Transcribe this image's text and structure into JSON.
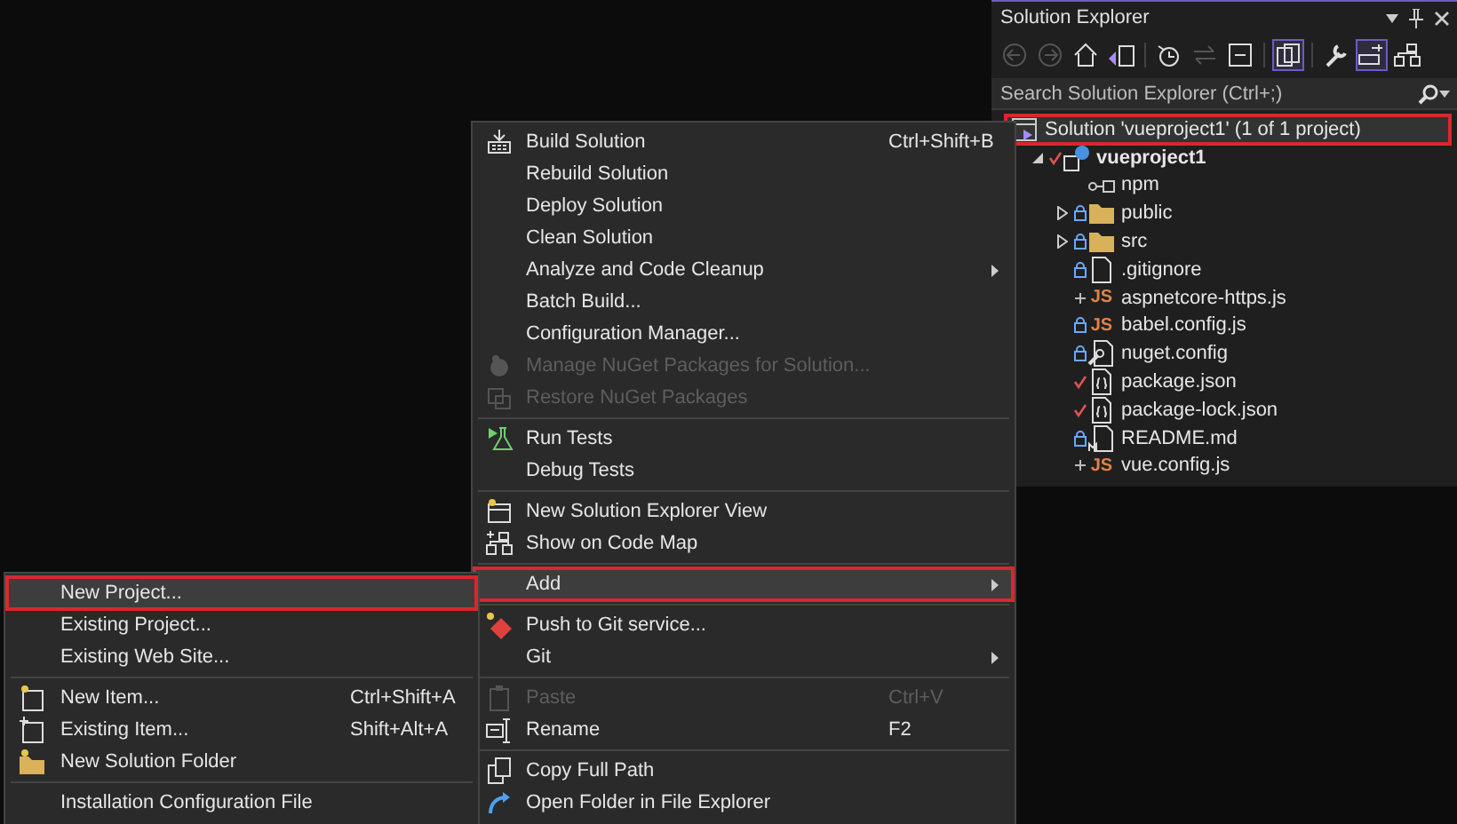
{
  "explorer": {
    "title": "Solution Explorer",
    "toolbar": [
      {
        "kind": "back",
        "on": false,
        "disabled": true
      },
      {
        "kind": "forward",
        "on": false,
        "disabled": true
      },
      {
        "kind": "home",
        "on": false,
        "disabled": false
      },
      {
        "kind": "switch-views",
        "on": false,
        "disabled": false
      },
      {
        "kind": "history",
        "on": false,
        "disabled": false
      },
      {
        "kind": "sync",
        "on": false,
        "disabled": true
      },
      {
        "kind": "collapse",
        "on": false,
        "disabled": false
      },
      {
        "kind": "show-all",
        "on": true,
        "disabled": false
      },
      {
        "kind": "properties",
        "on": false,
        "disabled": false
      },
      {
        "kind": "preview",
        "on": true,
        "disabled": false
      },
      {
        "kind": "code-map",
        "on": false,
        "disabled": false
      }
    ],
    "search": {
      "placeholder": "Search Solution Explorer (Ctrl+;)"
    },
    "tree": {
      "label": "Solution 'vueproject1' (1 of 1 project)",
      "kind": "solution",
      "highlighted": true,
      "children": [
        {
          "label": "vueproject1",
          "kind": "web-project",
          "checked_in": false,
          "pending_add": false,
          "pending_edit": true,
          "expanded": true,
          "children": [
            {
              "label": "npm",
              "kind": "dependency",
              "checked_in": false,
              "pending_add": false,
              "pending_edit": false
            },
            {
              "label": "public",
              "kind": "folder",
              "checked_in": true,
              "pending_add": false,
              "pending_edit": false,
              "expanded": false
            },
            {
              "label": "src",
              "kind": "folder",
              "checked_in": true,
              "pending_add": false,
              "pending_edit": false,
              "expanded": false
            },
            {
              "label": ".gitignore",
              "kind": "file",
              "checked_in": true,
              "pending_add": false,
              "pending_edit": false
            },
            {
              "label": "aspnetcore-https.js",
              "kind": "js",
              "badge": "JS",
              "checked_in": false,
              "pending_add": true,
              "pending_edit": false
            },
            {
              "label": "babel.config.js",
              "kind": "js",
              "badge": "JS",
              "checked_in": true,
              "pending_add": false,
              "pending_edit": false
            },
            {
              "label": "nuget.config",
              "kind": "config",
              "checked_in": true,
              "pending_add": false,
              "pending_edit": false
            },
            {
              "label": "package.json",
              "kind": "json",
              "checked_in": false,
              "pending_add": false,
              "pending_edit": true
            },
            {
              "label": "package-lock.json",
              "kind": "json",
              "checked_in": false,
              "pending_add": false,
              "pending_edit": true
            },
            {
              "label": "README.md",
              "kind": "markdown",
              "checked_in": true,
              "pending_add": false,
              "pending_edit": false
            },
            {
              "label": "vue.config.js",
              "kind": "js",
              "badge": "JS",
              "checked_in": false,
              "pending_add": true,
              "pending_edit": false
            }
          ]
        }
      ]
    }
  },
  "main_menu": {
    "items": [
      {
        "kind": "build",
        "label": "Build Solution",
        "shortcut": "Ctrl+Shift+B",
        "disabled": false,
        "selected": false,
        "highlighted": false,
        "submenu": false
      },
      {
        "kind": "plain",
        "label": "Rebuild Solution",
        "disabled": false,
        "selected": false,
        "highlighted": false,
        "submenu": false
      },
      {
        "kind": "plain",
        "label": "Deploy Solution",
        "disabled": false,
        "selected": false,
        "highlighted": false,
        "submenu": false
      },
      {
        "kind": "plain",
        "label": "Clean Solution",
        "disabled": false,
        "selected": false,
        "highlighted": false,
        "submenu": false
      },
      {
        "kind": "plain",
        "label": "Analyze and Code Cleanup",
        "disabled": false,
        "selected": false,
        "highlighted": false,
        "submenu": true
      },
      {
        "kind": "plain",
        "label": "Batch Build...",
        "disabled": false,
        "selected": false,
        "highlighted": false,
        "submenu": false
      },
      {
        "kind": "plain",
        "label": "Configuration Manager...",
        "disabled": false,
        "selected": false,
        "highlighted": false,
        "submenu": false
      },
      {
        "kind": "package",
        "label": "Manage NuGet Packages for Solution...",
        "disabled": true,
        "selected": false,
        "highlighted": false,
        "submenu": false
      },
      {
        "kind": "restore",
        "label": "Restore NuGet Packages",
        "disabled": true,
        "selected": false,
        "highlighted": false,
        "submenu": false
      },
      {
        "kind": "separator"
      },
      {
        "kind": "flask",
        "label": "Run Tests",
        "disabled": false,
        "selected": false,
        "highlighted": false,
        "submenu": false
      },
      {
        "kind": "plain",
        "label": "Debug Tests",
        "disabled": false,
        "selected": false,
        "highlighted": false,
        "submenu": false
      },
      {
        "kind": "separator"
      },
      {
        "kind": "new-view",
        "label": "New Solution Explorer View",
        "disabled": false,
        "selected": false,
        "highlighted": false,
        "submenu": false
      },
      {
        "kind": "code-map",
        "label": "Show on Code Map",
        "disabled": false,
        "selected": false,
        "highlighted": false,
        "submenu": false
      },
      {
        "kind": "separator"
      },
      {
        "kind": "plain",
        "label": "Add",
        "disabled": false,
        "selected": true,
        "highlighted": true,
        "submenu": true
      },
      {
        "kind": "separator"
      },
      {
        "kind": "git-push",
        "label": "Push to Git service...",
        "disabled": false,
        "selected": false,
        "highlighted": false,
        "submenu": false
      },
      {
        "kind": "plain",
        "label": "Git",
        "disabled": false,
        "selected": false,
        "highlighted": false,
        "submenu": true
      },
      {
        "kind": "separator"
      },
      {
        "kind": "paste",
        "label": "Paste",
        "shortcut": "Ctrl+V",
        "disabled": true,
        "selected": false,
        "highlighted": false,
        "submenu": false
      },
      {
        "kind": "rename",
        "label": "Rename",
        "shortcut": "F2",
        "disabled": false,
        "selected": false,
        "highlighted": false,
        "submenu": false
      },
      {
        "kind": "separator"
      },
      {
        "kind": "copy",
        "label": "Copy Full Path",
        "disabled": false,
        "selected": false,
        "highlighted": false,
        "submenu": false
      },
      {
        "kind": "open-folder",
        "label": "Open Folder in File Explorer",
        "disabled": false,
        "selected": false,
        "highlighted": false,
        "submenu": false
      }
    ]
  },
  "add_menu": {
    "items": [
      {
        "kind": "plain",
        "label": "New Project...",
        "disabled": false,
        "selected": true,
        "highlighted": true,
        "submenu": false
      },
      {
        "kind": "plain",
        "label": "Existing Project...",
        "disabled": false,
        "selected": false,
        "highlighted": false,
        "submenu": false
      },
      {
        "kind": "plain",
        "label": "Existing Web Site...",
        "disabled": false,
        "selected": false,
        "highlighted": false,
        "submenu": false
      },
      {
        "kind": "separator"
      },
      {
        "kind": "new-item",
        "label": "New Item...",
        "shortcut": "Ctrl+Shift+A",
        "disabled": false,
        "selected": false,
        "highlighted": false,
        "submenu": false
      },
      {
        "kind": "existing-item",
        "label": "Existing Item...",
        "shortcut": "Shift+Alt+A",
        "disabled": false,
        "selected": false,
        "highlighted": false,
        "submenu": false
      },
      {
        "kind": "new-folder",
        "label": "New Solution Folder",
        "disabled": false,
        "selected": false,
        "highlighted": false,
        "submenu": false
      },
      {
        "kind": "separator"
      },
      {
        "kind": "plain",
        "label": "Installation Configuration File",
        "disabled": false,
        "selected": false,
        "highlighted": false,
        "submenu": false
      }
    ]
  }
}
